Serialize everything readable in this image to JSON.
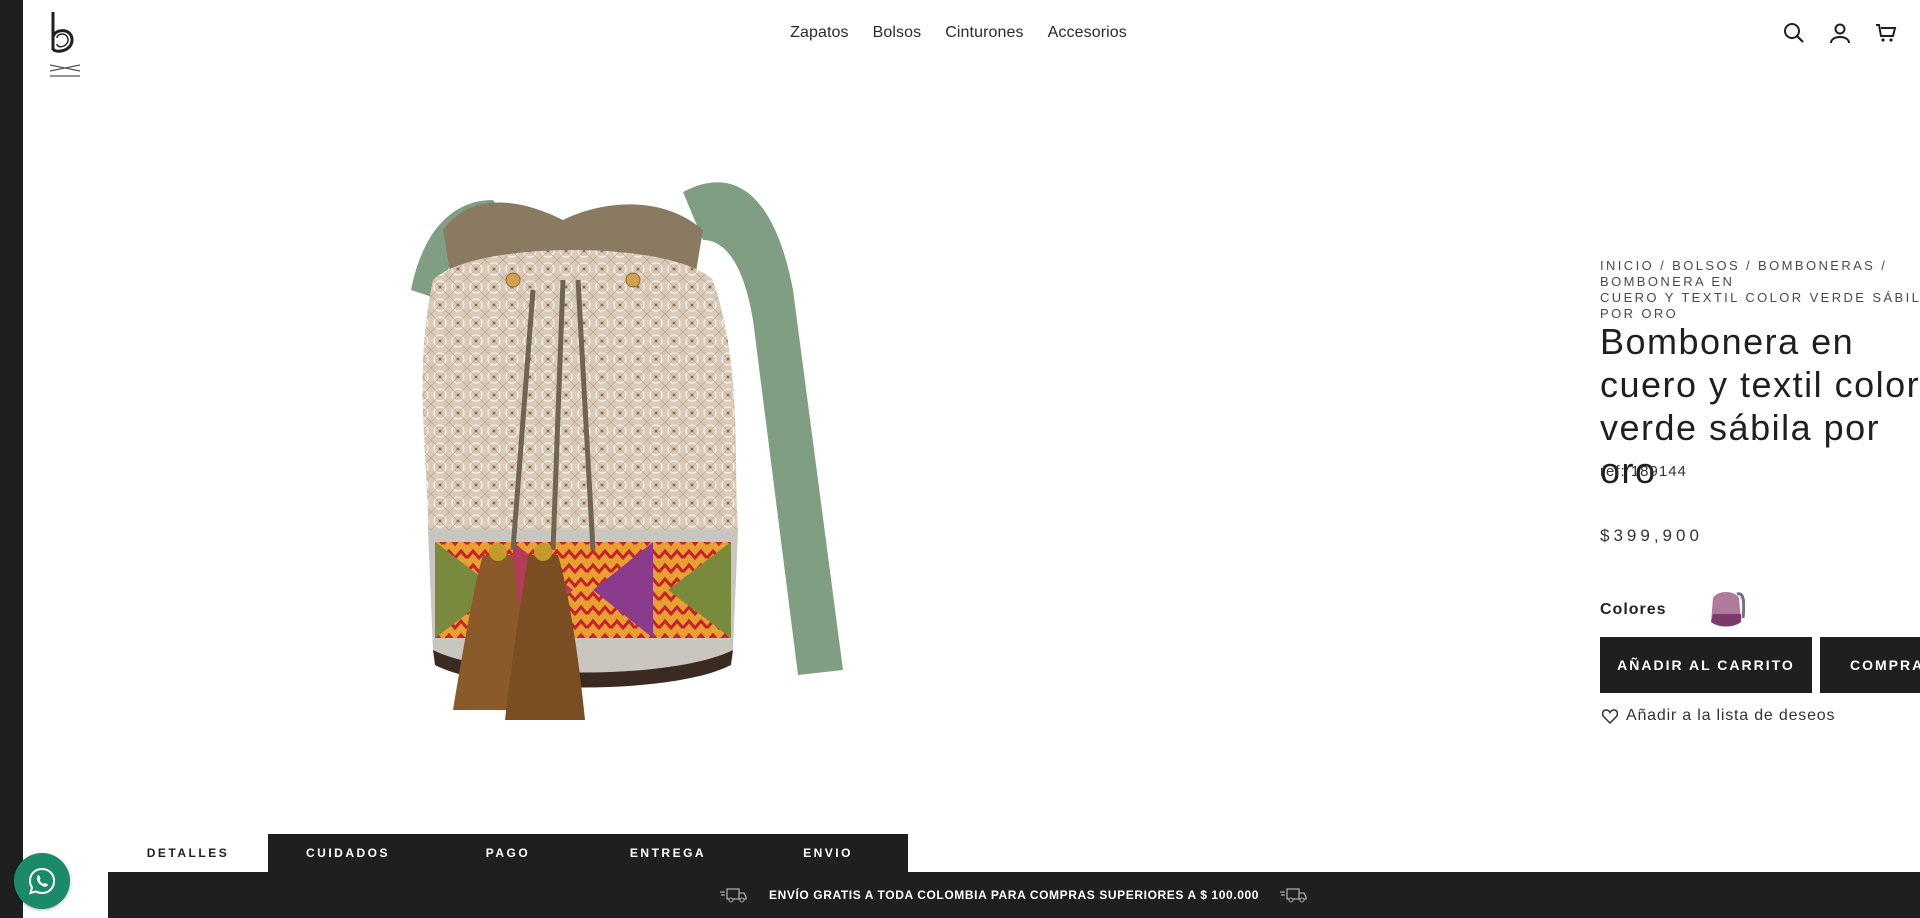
{
  "header": {
    "nav": [
      "Zapatos",
      "Bolsos",
      "Cinturones",
      "Accesorios"
    ],
    "icons": [
      "search-icon",
      "user-icon",
      "cart-icon"
    ]
  },
  "product": {
    "breadcrumb": "INICIO / BOLSOS / BOMBONERAS / BOMBONERA EN\nCUERO Y TEXTIL COLOR VERDE SÁBILA POR ORO",
    "title": "Bombonera en cuero y textil color verde sábila por oro",
    "ref": "ref: 189144",
    "price": "$399,900",
    "colors_label": "Colores",
    "add_to_cart": "AÑADIR AL CARRITO",
    "buy": "COMPRAR",
    "wishlist": "Añadir a la lista de deseos"
  },
  "tabs": [
    {
      "label": "DETALLES",
      "active": true
    },
    {
      "label": "CUIDADOS",
      "active": false
    },
    {
      "label": "PAGO",
      "active": false
    },
    {
      "label": "ENTREGA",
      "active": false
    },
    {
      "label": "ENVIO",
      "active": false
    }
  ],
  "shipping": {
    "text": "ENVÍO GRATIS A TODA COLOMBIA PARA COMPRAS SUPERIORES A $ 100.000"
  },
  "colors": {
    "dark": "#1f1f1f",
    "whatsapp": "#1a8a6a",
    "strap_green": "#7f9e82"
  }
}
